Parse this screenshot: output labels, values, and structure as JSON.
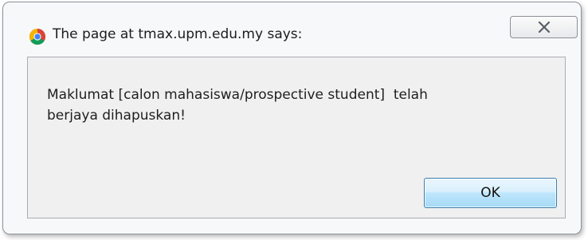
{
  "dialog": {
    "title": "The page at tmax.upm.edu.my says:",
    "message": "Maklumat [calon mahasiswa/prospective student]  telah\nberjaya dihapuskan!",
    "ok_label": "OK",
    "icons": {
      "app": "chrome-icon",
      "close": "close-icon"
    }
  }
}
